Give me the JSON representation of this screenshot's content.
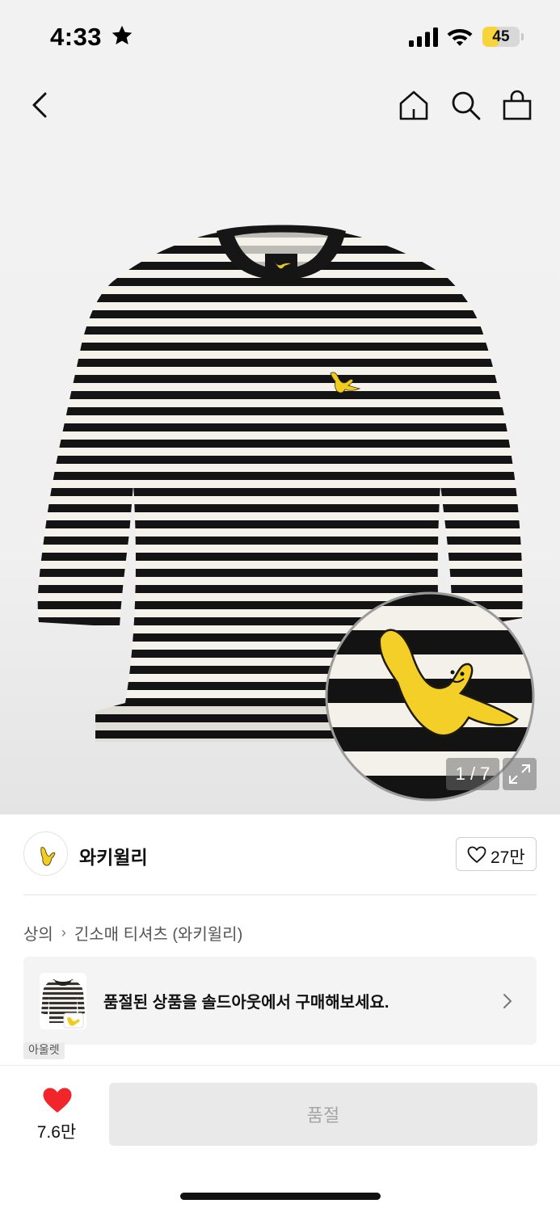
{
  "status_bar": {
    "time": "4:33",
    "battery_percent": "45",
    "battery_level": 0.45,
    "battery_color": "#f7d43a"
  },
  "nav": {
    "icons": [
      "back-icon",
      "home-icon",
      "search-icon",
      "shopping-bag-icon"
    ]
  },
  "product_image": {
    "counter": "1 / 7",
    "current_image": 1,
    "total_images": 7
  },
  "brand": {
    "name": "와키윌리",
    "like_count": "27만"
  },
  "breadcrumb": {
    "items": [
      "상의",
      "긴소매 티셔츠 (와키윌리)"
    ]
  },
  "promo": {
    "text": "품절된 상품을 솔드아웃에서 구매해보세요.",
    "tag": "아울렛"
  },
  "bottom_bar": {
    "wishlist_count": "7.6만",
    "buy_label": "품절",
    "heart_color": "#f0262a"
  }
}
